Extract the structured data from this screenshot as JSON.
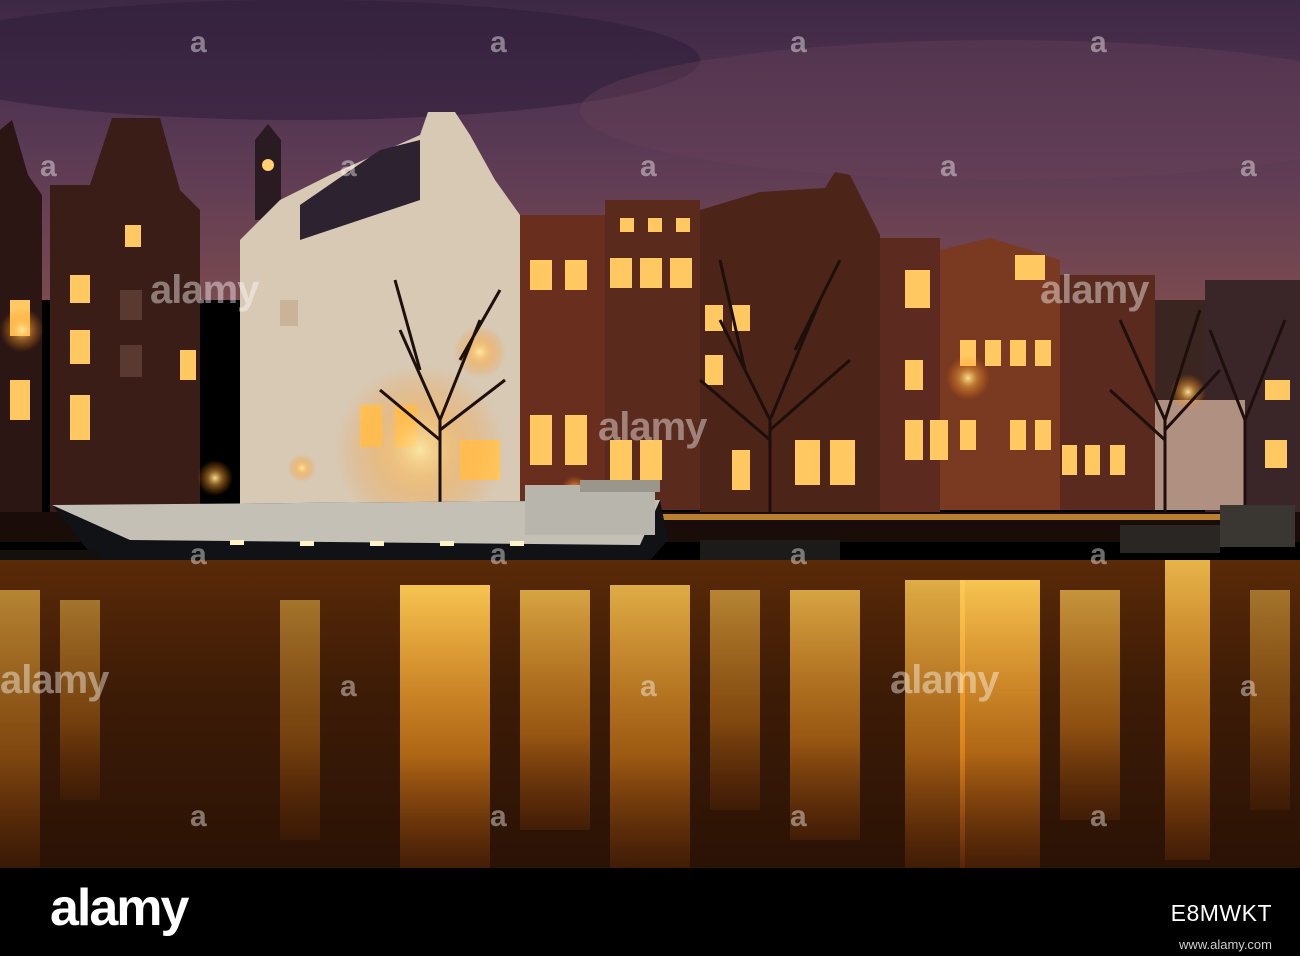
{
  "watermark": {
    "word": "alamy",
    "mark": "a"
  },
  "footer": {
    "logo": "alamy",
    "image_id": "E8MWKT",
    "site": "www.alamy.com"
  }
}
